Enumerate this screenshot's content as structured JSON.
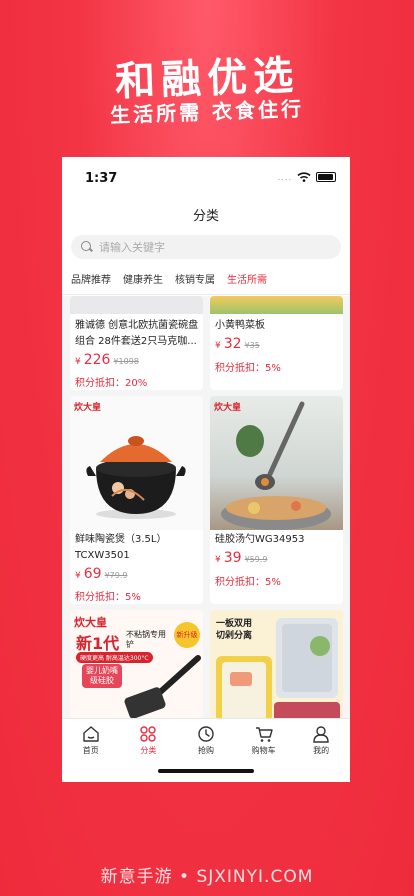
{
  "promo": {
    "title": "和融优选",
    "subtitle": "生活所需 衣食住行"
  },
  "status_bar": {
    "time": "1:37",
    "signal": "...."
  },
  "nav": {
    "title": "分类"
  },
  "search": {
    "placeholder": "请输入关键字"
  },
  "tabs": [
    {
      "label": "品牌推荐",
      "active": false
    },
    {
      "label": "健康养生",
      "active": false
    },
    {
      "label": "核销专属",
      "active": false
    },
    {
      "label": "生活所需",
      "active": true
    }
  ],
  "products": [
    {
      "name": "雅诚德 创意北欧抗菌瓷碗盘组合 28件套送2只马克咖...",
      "currency": "¥",
      "price": "226",
      "original": "¥1098",
      "points": "积分抵扣：20%"
    },
    {
      "name": "小黄鸭菜板",
      "currency": "¥",
      "price": "32",
      "original": "¥35",
      "points": "积分抵扣：5%"
    },
    {
      "name": "鲜味陶瓷煲（3.5L）TCXW3501",
      "currency": "¥",
      "price": "69",
      "original": "¥79.9",
      "points": "积分抵扣：5%",
      "brand": "炊大皇"
    },
    {
      "name": "硅胶汤勺WG34953",
      "currency": "¥",
      "price": "39",
      "original": "¥59.9",
      "points": "积分抵扣：5%",
      "brand": "炊大皇"
    },
    {
      "brand": "炊大皇",
      "headline": "新1代",
      "tag1": "不粘锅专用铲",
      "tag2": "新升级",
      "tag3": "硬度更高 耐高温达300°C",
      "tag4": "婴儿奶嘴级硅胶"
    },
    {
      "headline": "一板双用",
      "tag1": "切剁分离"
    }
  ],
  "tabbar": [
    {
      "label": "首页",
      "icon": "home-icon",
      "active": false
    },
    {
      "label": "分类",
      "icon": "category-icon",
      "active": true
    },
    {
      "label": "抢购",
      "icon": "clock-icon",
      "active": false
    },
    {
      "label": "购物车",
      "icon": "cart-icon",
      "active": false
    },
    {
      "label": "我的",
      "icon": "user-icon",
      "active": false
    }
  ],
  "watermark": "新意手游 • SJXINYI.COM",
  "colors": {
    "accent": "#ee2b3c",
    "background": "#f23444"
  }
}
